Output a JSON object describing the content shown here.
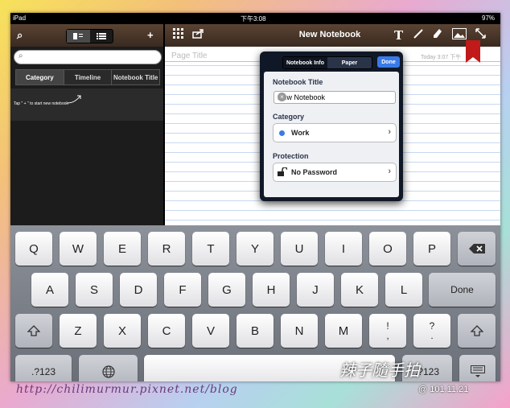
{
  "status_bar": {
    "device": "iPad",
    "time": "下午3:08",
    "battery": "97%"
  },
  "left_panel": {
    "tabs": [
      "Category",
      "Timeline",
      "Notebook Title"
    ],
    "hint": "Tap \" + \" to start new notebook"
  },
  "notebook": {
    "title": "New Notebook",
    "page_title_placeholder": "Page Title",
    "date": "Today 3:07 下午"
  },
  "popover": {
    "tabs": [
      "Notebook Info",
      "Paper"
    ],
    "done_label": "Done",
    "title_label": "Notebook Title",
    "title_value": "New Notebook",
    "category_label": "Category",
    "category_value": "Work",
    "protection_label": "Protection",
    "protection_value": "No Password"
  },
  "keyboard": {
    "row1": [
      "Q",
      "W",
      "E",
      "R",
      "T",
      "Y",
      "U",
      "I",
      "O",
      "P"
    ],
    "row2": [
      "A",
      "S",
      "D",
      "F",
      "G",
      "H",
      "J",
      "K",
      "L"
    ],
    "row3": [
      "Z",
      "X",
      "C",
      "V",
      "B",
      "N",
      "M"
    ],
    "done": "Done",
    "punct1": [
      "!",
      ","
    ],
    "punct2": [
      "?",
      "."
    ],
    "num_left": ".?123",
    "num_right": ".?123"
  },
  "watermark": {
    "url": "http://chilimurmur.pixnet.net/blog",
    "signature": "辣子隨手拍",
    "date": "@ 101.11.21"
  }
}
